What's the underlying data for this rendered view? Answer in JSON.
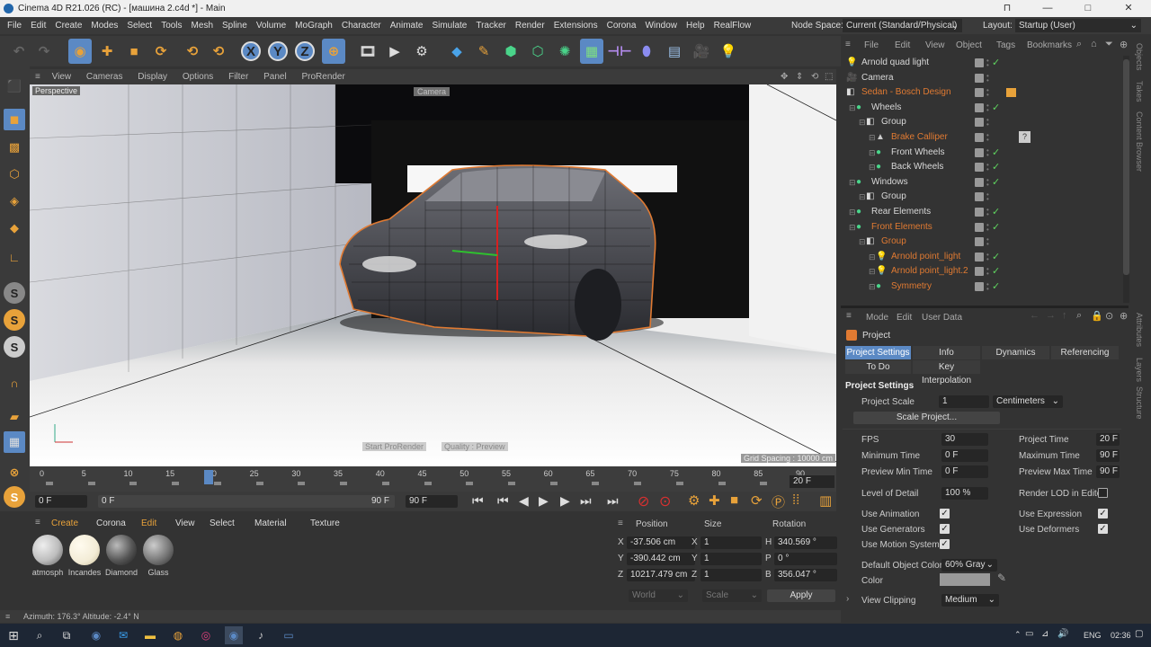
{
  "window": {
    "title": "Cinema 4D R21.026 (RC) - [машина 2.c4d *] - Main",
    "controls": [
      "⊓",
      "—",
      "□",
      "✕"
    ]
  },
  "menubar": {
    "items": [
      "File",
      "Edit",
      "Create",
      "Modes",
      "Select",
      "Tools",
      "Mesh",
      "Spline",
      "Volume",
      "MoGraph",
      "Character",
      "Animate",
      "Simulate",
      "Tracker",
      "Render",
      "Extensions",
      "Corona",
      "Window",
      "Help",
      "RealFlow"
    ],
    "node_space_label": "Node Space:",
    "node_space_value": "Current (Standard/Physical)",
    "layout_label": "Layout:",
    "layout_value": "Startup (User)"
  },
  "toolbar": {
    "icons": [
      "undo-icon",
      "redo-icon",
      "live-select-icon",
      "move-icon",
      "scale-icon",
      "rotate-icon",
      "recent-tool-icon",
      "x-axis-icon",
      "y-axis-icon",
      "z-axis-icon",
      "coordinate-system-icon",
      "render-view-icon",
      "render-picture-queue-icon",
      "render-settings-icon",
      "cube-icon",
      "pen-icon",
      "subdivision-icon",
      "extrude-icon",
      "array-icon",
      "cloner-icon",
      "symmetry-icon",
      "deformer-icon",
      "floor-icon",
      "camera-icon",
      "light-icon"
    ],
    "axis_labels": [
      "X",
      "Y",
      "Z"
    ]
  },
  "viewport": {
    "menu": [
      "View",
      "Cameras",
      "Display",
      "Options",
      "Filter",
      "Panel",
      "ProRender"
    ],
    "label": "Perspective",
    "camera_tag": "Camera",
    "grid_spacing": "Grid Spacing : 10000 cm",
    "overlay_left": "Start ProRender",
    "overlay_right": "Quality : Preview"
  },
  "timeline": {
    "ticks": [
      "0",
      "5",
      "10",
      "15",
      "20",
      "25",
      "30",
      "35",
      "40",
      "45",
      "50",
      "55",
      "60",
      "65",
      "70",
      "75",
      "80",
      "85",
      "90"
    ],
    "current_frame": "20",
    "frame_display": "20 F",
    "start": "0 F",
    "range_start": "0 F",
    "range_end": "90 F",
    "end": "90 F"
  },
  "materials": {
    "menu": [
      "Create",
      "Corona",
      "Edit",
      "View",
      "Select",
      "Material",
      "Texture"
    ],
    "items": [
      {
        "name": "atmosph",
        "color": "#bdbdbd"
      },
      {
        "name": "Incandes",
        "color": "#f3ecd6"
      },
      {
        "name": "Diamond",
        "color": "#777"
      },
      {
        "name": "Glass",
        "color": "#999"
      }
    ]
  },
  "coords": {
    "headers": [
      "Position",
      "Size",
      "Rotation"
    ],
    "rows": [
      {
        "axis": "X",
        "pos": "-37.506 cm",
        "size_axis": "X",
        "size": "1",
        "rot_axis": "H",
        "rot": "340.569 °"
      },
      {
        "axis": "Y",
        "pos": "-390.442 cm",
        "size_axis": "Y",
        "size": "1",
        "rot_axis": "P",
        "rot": "0 °"
      },
      {
        "axis": "Z",
        "pos": "10217.479 cm",
        "size_axis": "Z",
        "size": "1",
        "rot_axis": "B",
        "rot": "356.047 °"
      }
    ],
    "space": "World",
    "scale_mode": "Scale",
    "apply": "Apply"
  },
  "statusbar": {
    "text": "Azimuth: 176.3°  Altitude: -2.4°  N"
  },
  "objmgr": {
    "menu": [
      "File",
      "Edit",
      "View",
      "Object",
      "Tags",
      "Bookmarks"
    ],
    "rows": [
      {
        "name": "Arnold quad light",
        "indent": 0,
        "icon": "💡",
        "color": "#d8d8d8",
        "check": true,
        "extra": ""
      },
      {
        "name": "Camera",
        "indent": 0,
        "icon": "🎥",
        "color": "#d8d8d8",
        "check": false,
        "extra": "cam"
      },
      {
        "name": "Sedan - Bosch Design",
        "indent": 0,
        "icon": "◧",
        "color": "#e07a32",
        "check": false,
        "extra": "tag"
      },
      {
        "name": "Wheels",
        "indent": 1,
        "icon": "●",
        "color": "#d8d8d8",
        "check": true,
        "extra": ""
      },
      {
        "name": "Group",
        "indent": 2,
        "icon": "◧",
        "color": "#d8d8d8",
        "check": false,
        "extra": ""
      },
      {
        "name": "Brake Calliper",
        "indent": 3,
        "icon": "▲",
        "color": "#e07a32",
        "check": false,
        "extra": "q"
      },
      {
        "name": "Front Wheels",
        "indent": 3,
        "icon": "●",
        "color": "#d8d8d8",
        "check": true,
        "extra": ""
      },
      {
        "name": "Back Wheels",
        "indent": 3,
        "icon": "●",
        "color": "#d8d8d8",
        "check": true,
        "extra": ""
      },
      {
        "name": "Windows",
        "indent": 1,
        "icon": "●",
        "color": "#d8d8d8",
        "check": true,
        "extra": ""
      },
      {
        "name": "Group",
        "indent": 2,
        "icon": "◧",
        "color": "#d8d8d8",
        "check": false,
        "extra": "dot"
      },
      {
        "name": "Rear Elements",
        "indent": 1,
        "icon": "●",
        "color": "#d8d8d8",
        "check": true,
        "extra": ""
      },
      {
        "name": "Front Elements",
        "indent": 1,
        "icon": "●",
        "color": "#e07a32",
        "check": true,
        "extra": ""
      },
      {
        "name": "Group",
        "indent": 2,
        "icon": "◧",
        "color": "#e07a32",
        "check": false,
        "extra": ""
      },
      {
        "name": "Arnold point_light",
        "indent": 3,
        "icon": "💡",
        "color": "#e07a32",
        "check": true,
        "extra": ""
      },
      {
        "name": "Arnold point_light.2",
        "indent": 3,
        "icon": "💡",
        "color": "#e07a32",
        "check": true,
        "extra": ""
      },
      {
        "name": "Symmetry",
        "indent": 3,
        "icon": "●",
        "color": "#e07a32",
        "check": true,
        "extra": ""
      }
    ]
  },
  "attr": {
    "menu": [
      "Mode",
      "Edit",
      "User Data"
    ],
    "title": "Project",
    "tabs": [
      "Project Settings",
      "Info",
      "Dynamics",
      "Referencing",
      "To Do",
      "Key Interpolation"
    ],
    "section": "Project Settings",
    "project_scale_label": "Project Scale",
    "project_scale_value": "1",
    "project_scale_unit": "Centimeters",
    "scale_project_btn": "Scale Project...",
    "fps_label": "FPS",
    "fps": "30",
    "project_time_label": "Project Time",
    "project_time": "20 F",
    "min_time_label": "Minimum Time",
    "min_time": "0 F",
    "max_time_label": "Maximum Time",
    "max_time": "90 F",
    "prev_min_label": "Preview Min Time",
    "prev_min": "0 F",
    "prev_max_label": "Preview Max Time",
    "prev_max": "90 F",
    "lod_label": "Level of Detail",
    "lod": "100 %",
    "render_lod_label": "Render LOD in Editor",
    "use_animation": "Use Animation",
    "use_expression": "Use Expression",
    "use_generators": "Use Generators",
    "use_deformers": "Use Deformers",
    "use_motion": "Use Motion System",
    "def_color_label": "Default Object Color",
    "def_color": "60% Gray",
    "color_label": "Color",
    "view_clipping_label": "View Clipping",
    "view_clipping": "Medium"
  },
  "side_tabs": {
    "right_top": [
      "Objects",
      "Takes",
      "Content Browser"
    ],
    "right_bottom": [
      "Attributes",
      "Layers",
      "Structure"
    ]
  },
  "taskbar": {
    "lang": "ENG",
    "time": "02:36"
  }
}
